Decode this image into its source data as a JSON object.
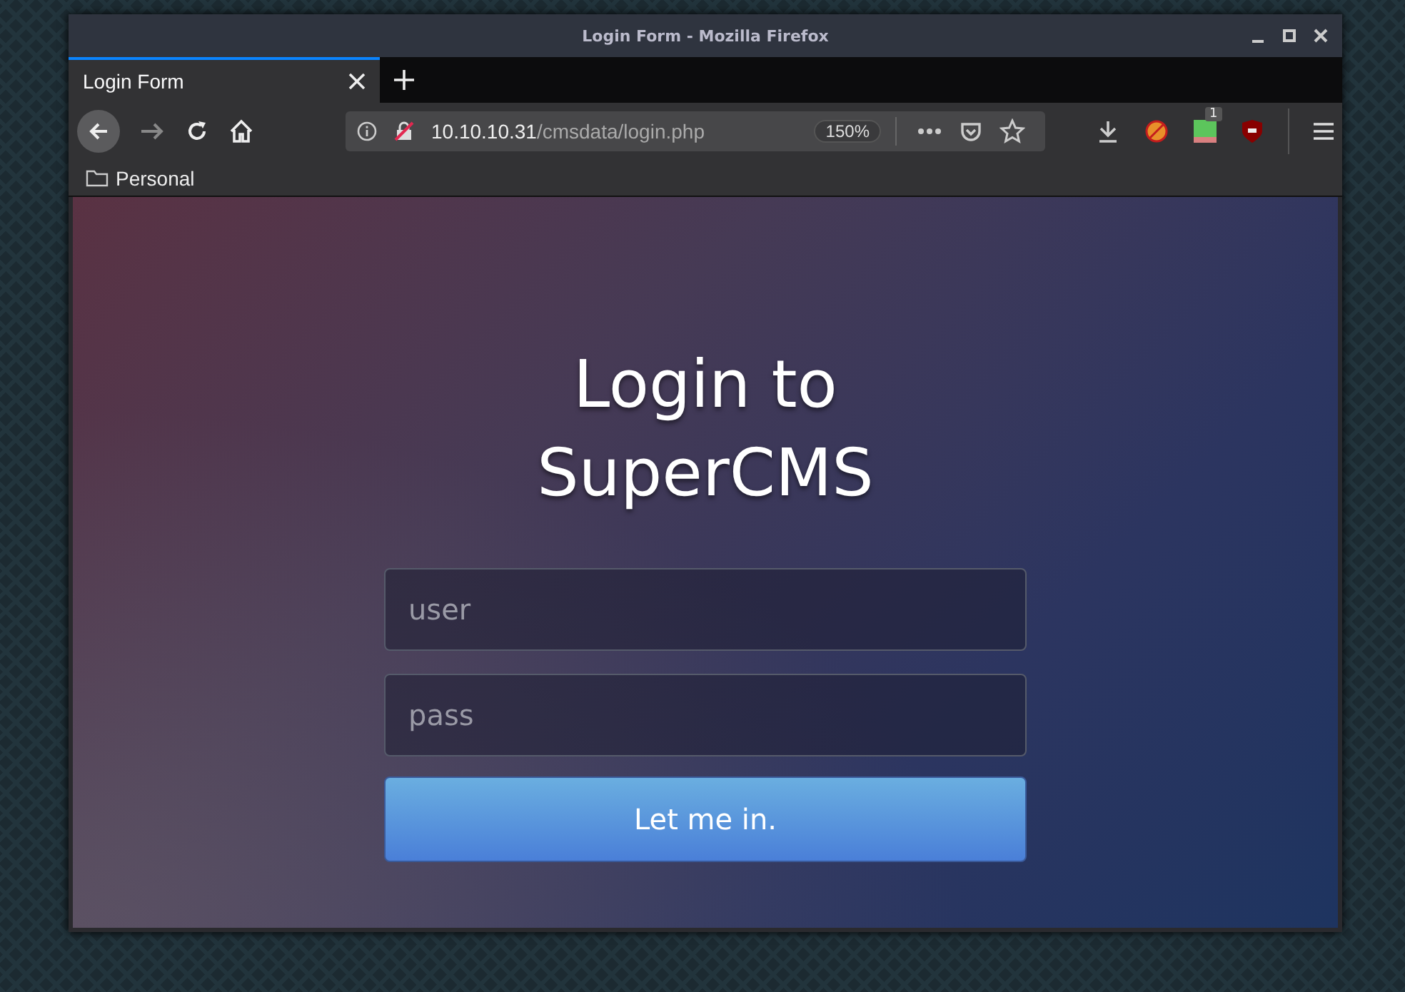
{
  "window": {
    "title": "Login Form - Mozilla Firefox"
  },
  "tabs": [
    {
      "label": "Login Form",
      "selected": true
    }
  ],
  "address_bar": {
    "host": "10.10.10.31",
    "path": "/cmsdata/login.php",
    "zoom": "150%"
  },
  "extension_badge": "1",
  "bookmarks": [
    "Personal"
  ],
  "page": {
    "heading": "Login to SuperCMS",
    "fields": [
      {
        "placeholder": "user"
      },
      {
        "placeholder": "pass"
      }
    ],
    "button": "Let me in."
  }
}
